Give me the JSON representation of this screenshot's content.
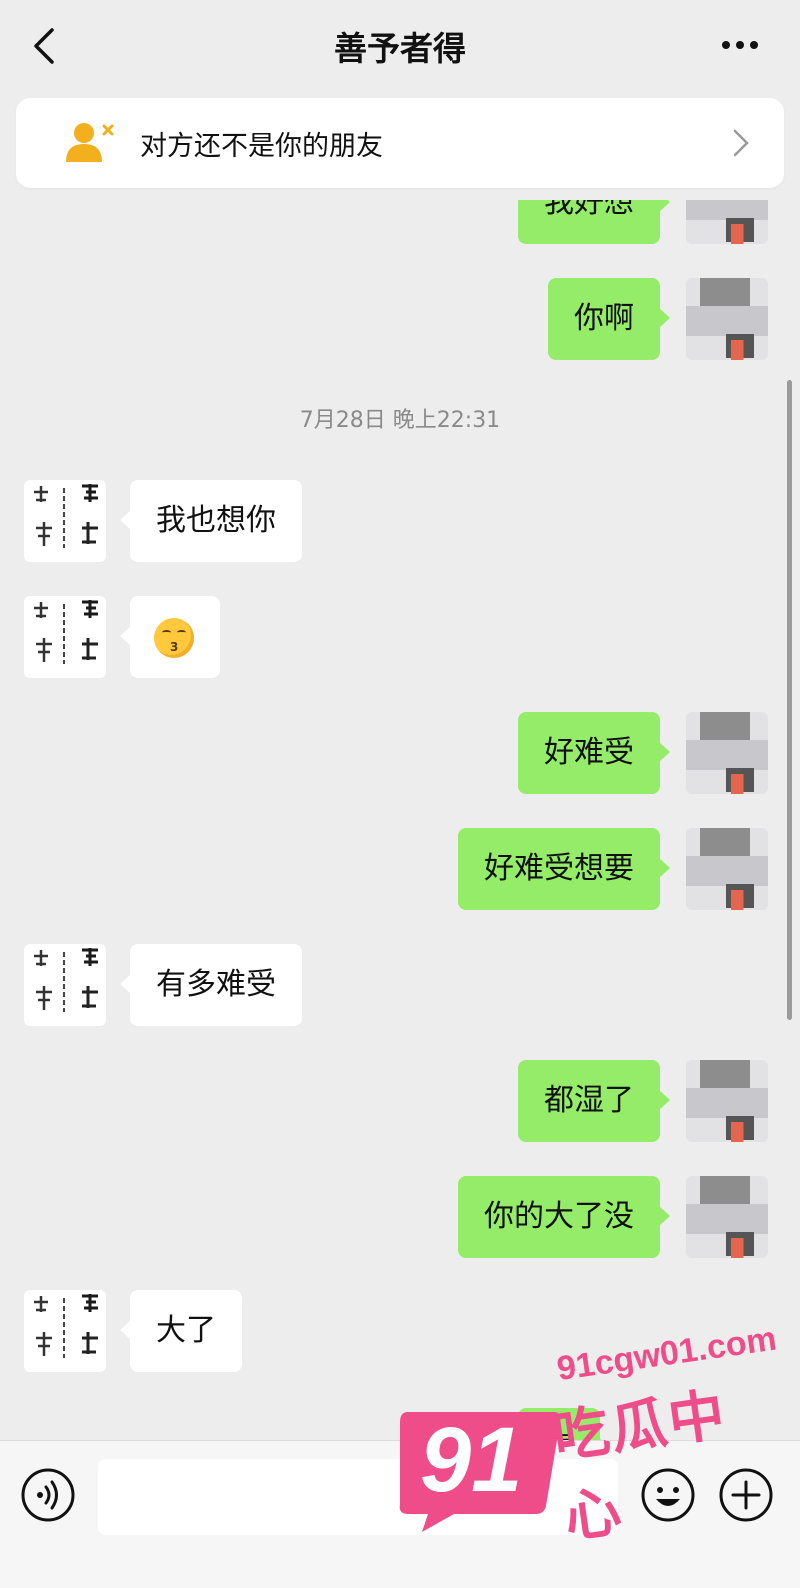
{
  "header": {
    "title": "善予者得"
  },
  "banner": {
    "text": "对方还不是你的朋友"
  },
  "chat": {
    "timestamp": "7月28日 晚上22:31",
    "messages": [
      {
        "side": "right",
        "text": "我好想"
      },
      {
        "side": "right",
        "text": "你啊"
      },
      {
        "side": "left",
        "text": "我也想你"
      },
      {
        "side": "left",
        "text": "",
        "emoji": "kissing-face"
      },
      {
        "side": "right",
        "text": "好难受"
      },
      {
        "side": "right",
        "text": "好难受想要"
      },
      {
        "side": "left",
        "text": "有多难受"
      },
      {
        "side": "right",
        "text": "都湿了"
      },
      {
        "side": "right",
        "text": "你的大了没"
      },
      {
        "side": "left",
        "text": "大了"
      },
      {
        "side": "right",
        "text": "想"
      }
    ]
  },
  "input": {
    "value": "",
    "placeholder": ""
  },
  "watermark": {
    "number": "91",
    "url": "91cgw01.com",
    "name": "吃瓜中心"
  },
  "colors": {
    "bg": "#ededed",
    "sent_bubble": "#95ec69",
    "received_bubble": "#ffffff",
    "warning_icon": "#f2b01e",
    "watermark": "#ee4d8a"
  }
}
